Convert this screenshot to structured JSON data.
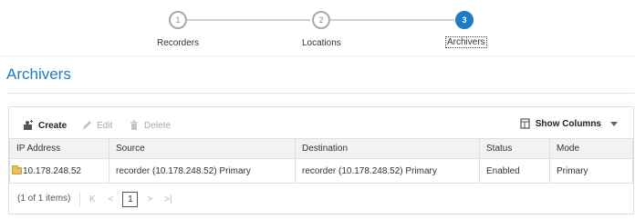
{
  "wizard": {
    "steps": [
      {
        "number": "1",
        "label": "Recorders"
      },
      {
        "number": "2",
        "label": "Locations"
      },
      {
        "number": "3",
        "label": "Archivers"
      }
    ]
  },
  "page": {
    "title": "Archivers"
  },
  "toolbar": {
    "create_label": "Create",
    "edit_label": "Edit",
    "delete_label": "Delete",
    "show_columns_label": "Show Columns"
  },
  "table": {
    "headers": [
      "IP Address",
      "Source",
      "Destination",
      "Status",
      "Mode"
    ],
    "rows": [
      {
        "ip": "10.178.248.52",
        "source": "recorder (10.178.248.52) Primary",
        "destination": "recorder (10.178.248.52) Primary",
        "status": "Enabled",
        "mode": "Primary"
      }
    ]
  },
  "pager": {
    "info": "(1 of 1 items)",
    "current_page": "1",
    "first_glyph": "K",
    "prev_glyph": "<",
    "next_glyph": ">",
    "last_glyph": ">|"
  },
  "colors": {
    "accent": "#1e7bc6",
    "header_bg": "#f2f2f2",
    "border": "#dedede"
  }
}
